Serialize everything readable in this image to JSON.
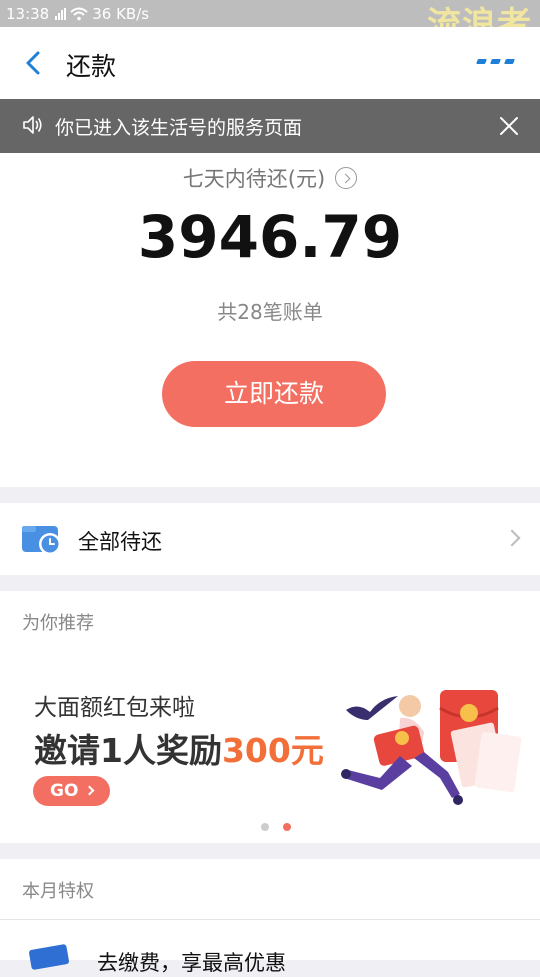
{
  "status_bar": {
    "time": "13:38",
    "speed": "36 KB/s"
  },
  "watermark": "流浪者",
  "nav": {
    "title": "还款",
    "back_icon": "back-arrow-icon",
    "more_icon": "more-icon"
  },
  "notice": {
    "text": "你已进入该生活号的服务页面"
  },
  "summary": {
    "label": "七天内待还(元)",
    "amount": "3946.79",
    "bill_count": "共28笔账单",
    "pay_button": "立即还款"
  },
  "all_pending": {
    "label": "全部待还"
  },
  "recommend": {
    "title": "为你推荐",
    "banner_line1": "大面额红包来啦",
    "banner_line2_prefix": "邀请1人奖励",
    "banner_line2_highlight": "300元",
    "go_label": "GO",
    "page_count": 2,
    "active_page": 2
  },
  "privileges": {
    "title": "本月特权",
    "first_item_partial": "去缴费，享最高优惠"
  },
  "colors": {
    "accent": "#f36f62",
    "link": "#1d7fd6",
    "notice_bg": "#666666"
  }
}
